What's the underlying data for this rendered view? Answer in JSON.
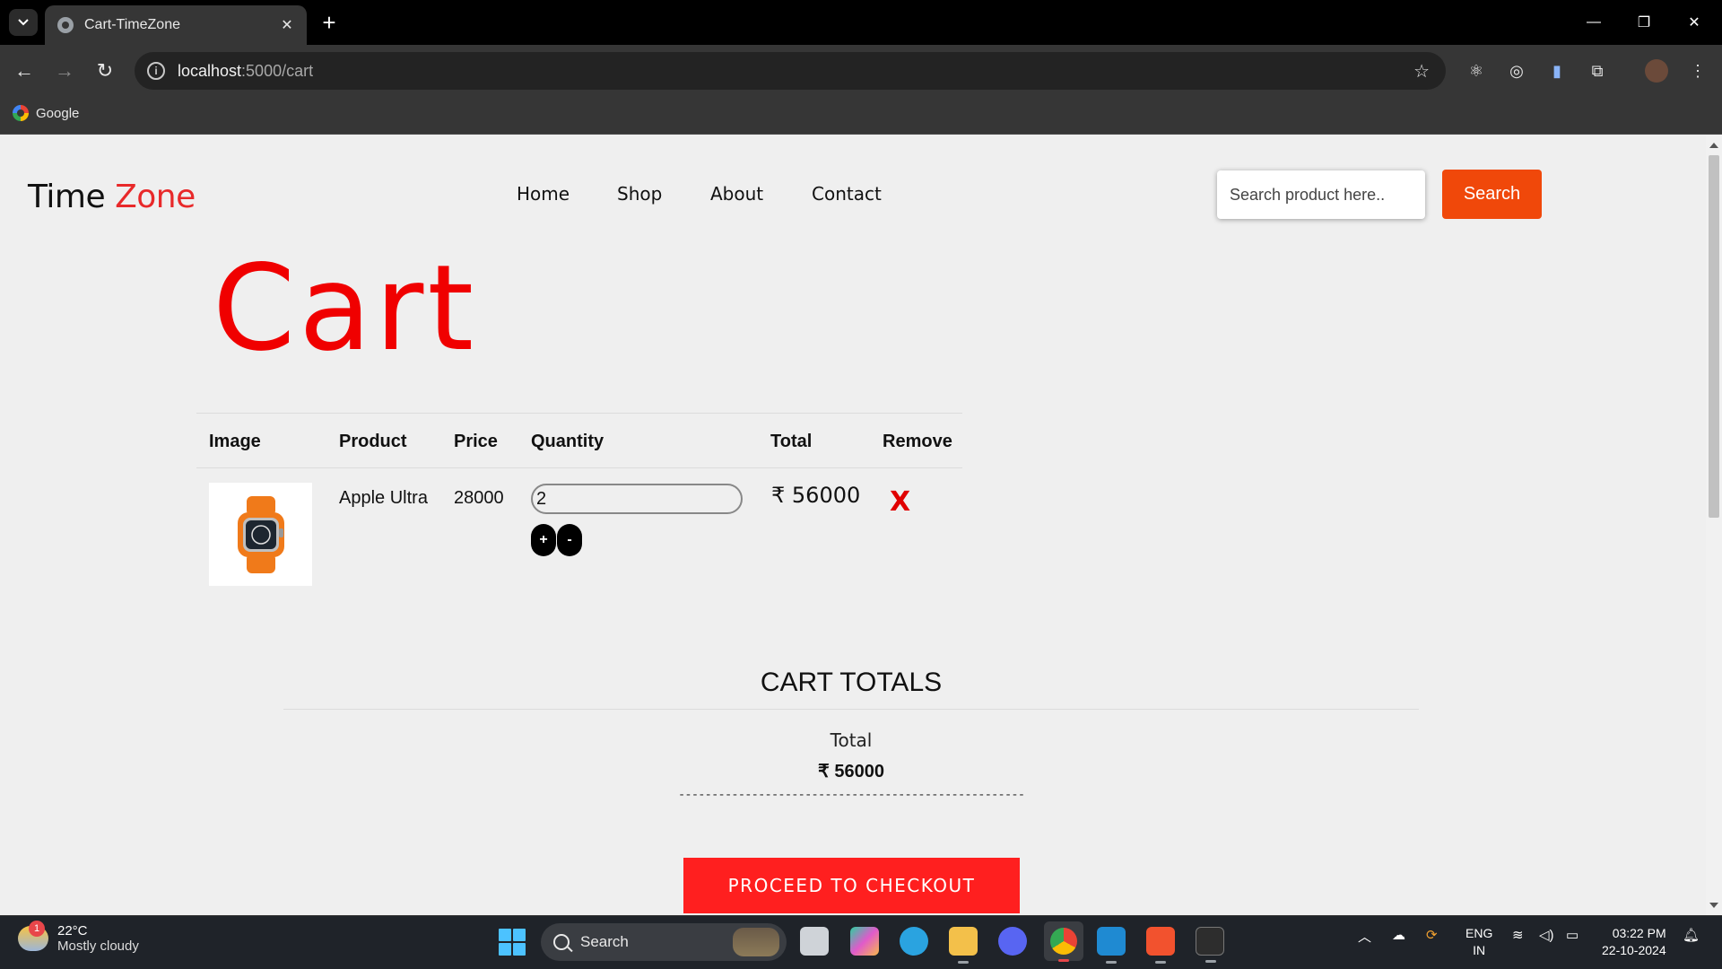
{
  "browser": {
    "tab_title": "Cart-TimeZone",
    "url_host": "localhost",
    "url_path": ":5000/cart",
    "bookmark": "Google"
  },
  "header": {
    "logo_part1": "Time",
    "logo_part2": "Zone",
    "nav": [
      "Home",
      "Shop",
      "About",
      "Contact"
    ],
    "search_placeholder": "Search product here..",
    "search_button": "Search"
  },
  "cart": {
    "title": "Cart",
    "columns": [
      "Image",
      "Product",
      "Price",
      "Quantity",
      "Total",
      "Remove"
    ],
    "rows": [
      {
        "product": "Apple Ultra",
        "price": "28000",
        "quantity": "2",
        "plus": "+",
        "minus": "-",
        "total": "₹ 56000",
        "remove": "X"
      }
    ]
  },
  "totals": {
    "heading": "CART TOTALS",
    "label": "Total",
    "amount": "₹ 56000",
    "divider": "----------------------------------------------------",
    "checkout": "PROCEED TO CHECKOUT"
  },
  "taskbar": {
    "temp": "22°C",
    "weather": "Mostly cloudy",
    "weather_badge": "1",
    "search": "Search",
    "lang1": "ENG",
    "lang2": "IN",
    "time": "03:22 PM",
    "date": "22-10-2024"
  },
  "colors": {
    "accent_red": "#f00000",
    "search_orange": "#f0480a",
    "checkout_red": "#ff1f1f"
  }
}
